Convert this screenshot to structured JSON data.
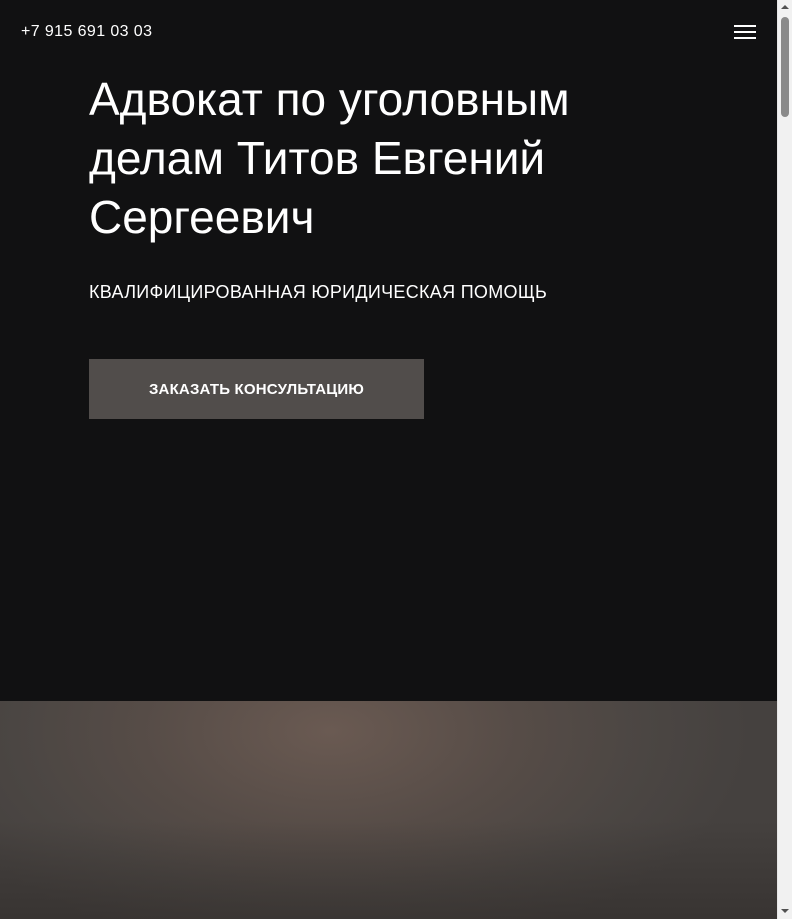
{
  "header": {
    "phone": "+7 915 691 03 03",
    "menu_icon": "hamburger-menu-icon"
  },
  "hero": {
    "title": "Адвокат по уголовным делам Титов Евгений Сергеевич",
    "subtitle": "КВАЛИФИЦИРОВАННАЯ ЮРИДИЧЕСКАЯ ПОМОЩЬ",
    "cta_label": "ЗАКАЗАТЬ КОНСУЛЬТАЦИЮ"
  },
  "colors": {
    "hero_background": "#111112",
    "button_background": "#514d4b",
    "text": "#ffffff"
  },
  "scrollbar": {
    "up_icon": "scroll-up-arrow-icon",
    "down_icon": "scroll-down-arrow-icon"
  }
}
